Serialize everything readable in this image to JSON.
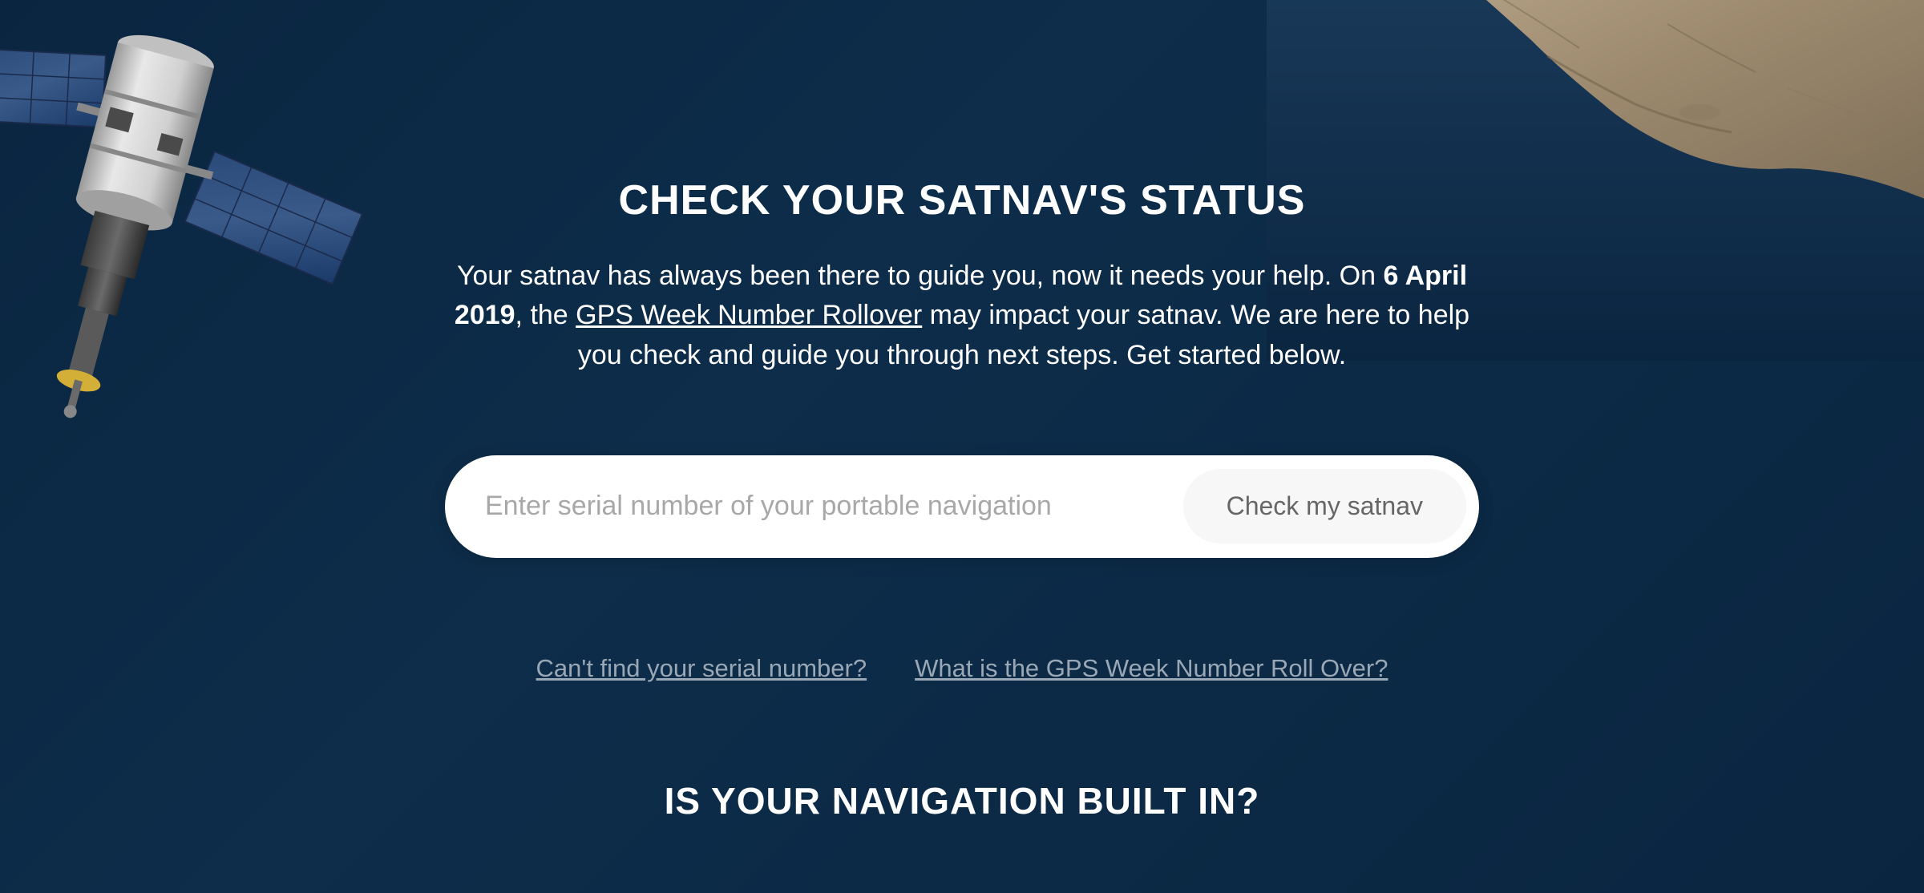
{
  "hero": {
    "heading": "CHECK YOUR SATNAV'S STATUS",
    "description_part1": "Your satnav has always been there to guide you, now it needs your help. On ",
    "description_bold_date": "6 April 2019",
    "description_part2": ", the ",
    "description_link": "GPS Week Number Rollover",
    "description_part3": " may impact your satnav. We are here to help you check and guide you through next steps. Get started below."
  },
  "search": {
    "placeholder": "Enter serial number of your portable navigation",
    "button_label": "Check my satnav"
  },
  "help_links": {
    "serial_help": "Can't find your serial number?",
    "rollover_info": "What is the GPS Week Number Roll Over?"
  },
  "secondary": {
    "heading": "IS YOUR NAVIGATION BUILT IN?"
  }
}
